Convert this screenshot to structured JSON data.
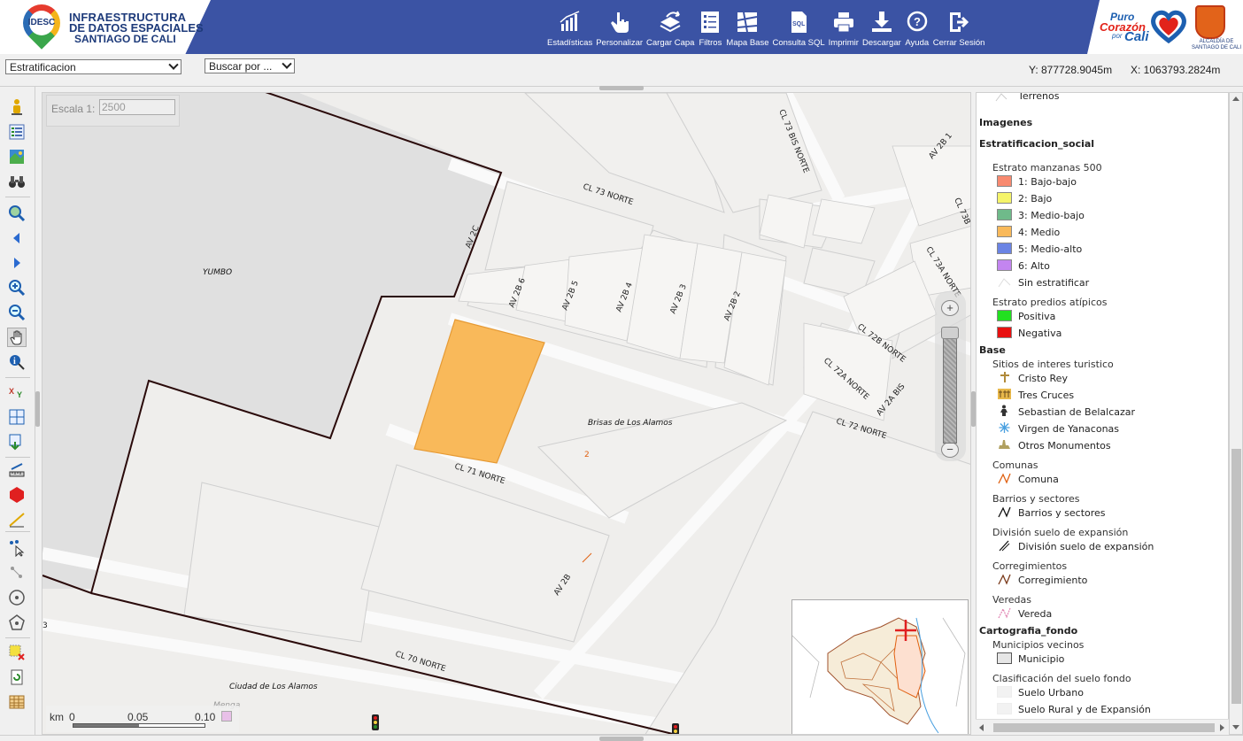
{
  "header": {
    "logo_abbr": "IDESC",
    "logo_line1": "INFRAESTRUCTURA",
    "logo_line2": "DE DATOS ESPACIALES",
    "logo_line3": "SANTIAGO DE CALI",
    "brand_puro": "Puro",
    "brand_corazon": "Corazón",
    "brand_por": "por",
    "brand_cali": "Cali",
    "brand_alcaldia": "ALCALDÍA DE SANTIAGO DE CALI"
  },
  "toolbar": [
    {
      "label": "Estadísticas",
      "icon": "bar-chart-icon"
    },
    {
      "label": "Personalizar",
      "icon": "hand-pointer-icon"
    },
    {
      "label": "Cargar Capa",
      "icon": "upload-layer-icon"
    },
    {
      "label": "Filtros",
      "icon": "filter-list-icon"
    },
    {
      "label": "Mapa Base",
      "icon": "base-map-icon"
    },
    {
      "label": "Consulta SQL",
      "icon": "sql-file-icon"
    },
    {
      "label": "Imprimir",
      "icon": "printer-icon"
    },
    {
      "label": "Descargar",
      "icon": "download-icon"
    },
    {
      "label": "Ayuda",
      "icon": "help-icon"
    },
    {
      "label": "Cerrar Sesión",
      "icon": "logout-icon"
    }
  ],
  "subbar": {
    "layer_select": "Estratificacion",
    "search_select": "Buscar por ...",
    "coord_y": "Y: 877728.9045m",
    "coord_x": "X: 1063793.2824m"
  },
  "map": {
    "scale_label": "Escala 1:",
    "scale_value": "2500",
    "km_label": "km",
    "km_ticks": [
      "0",
      "0.05",
      "0.10"
    ],
    "selected_fill": "#f9b95a",
    "labels": {
      "yumbo": "YUMBO",
      "brisas": "Brisas de Los Alamos",
      "ciudad": "Ciudad de Los Alamos",
      "comuna": "2",
      "menga": "Menga",
      "cl73n": "CL 73 NORTE",
      "cl73bis": "CL 73 BIS NORTE",
      "av2b1": "AV 2B 1",
      "cl73b": "CL 73B",
      "cl73an": "CL 73A NORTE",
      "av2c": "AV 2C",
      "av2b6": "AV 2B 6",
      "av2b5": "AV 2B 5",
      "av2b4": "AV 2B 4",
      "av2b3": "AV 2B 3",
      "av2b2": "AV 2B 2",
      "cl72bn": "CL 72B NORTE",
      "cl72an": "CL 72A NORTE",
      "av2abis": "AV 2A BIS",
      "cl72n": "CL 72 NORTE",
      "cl71n": "CL 71 NORTE",
      "av2b": "AV 2B",
      "cl70n": "CL 70 NORTE",
      "edge3": "3"
    }
  },
  "legend": {
    "terrenos": "Terrenos",
    "imagenes": "Imagenes",
    "estratificacion_social": "Estratificacion_social",
    "estrato_title": "Estrato manzanas 500",
    "estratos": [
      {
        "label": "1: Bajo-bajo",
        "color": "#f88a70"
      },
      {
        "label": "2: Bajo",
        "color": "#f5f46a"
      },
      {
        "label": "3: Medio-bajo",
        "color": "#6fba8a"
      },
      {
        "label": "4: Medio",
        "color": "#f9b95a"
      },
      {
        "label": "5: Medio-alto",
        "color": "#6b84e4"
      },
      {
        "label": "6: Alto",
        "color": "#c385f0"
      }
    ],
    "sin_estratificar": "Sin estratificar",
    "atipicos_title": "Estrato predios atípicos",
    "atipicos": [
      {
        "label": "Positiva",
        "color": "#22e020"
      },
      {
        "label": "Negativa",
        "color": "#e81010"
      }
    ],
    "base": "Base",
    "sitios_title": "Sitios de interes turistico",
    "sitios": [
      "Cristo Rey",
      "Tres Cruces",
      "Sebastian de Belalcazar",
      "Virgen de Yanaconas",
      "Otros Monumentos"
    ],
    "comunas_title": "Comunas",
    "comuna": "Comuna",
    "barrios_title": "Barrios y sectores",
    "barrios": "Barrios y sectores",
    "division_title": "División suelo de expansión",
    "division": "División suelo de expansión",
    "correg_title": "Corregimientos",
    "correg": "Corregimiento",
    "veredas_title": "Veredas",
    "vereda": "Vereda",
    "cartografia": "Cartografia_fondo",
    "municipios_title": "Municipios vecinos",
    "municipio": "Municipio",
    "clasif_title": "Clasificación del suelo fondo",
    "suelo_urbano": "Suelo Urbano",
    "suelo_rural": "Suelo Rural y de Expansión"
  }
}
